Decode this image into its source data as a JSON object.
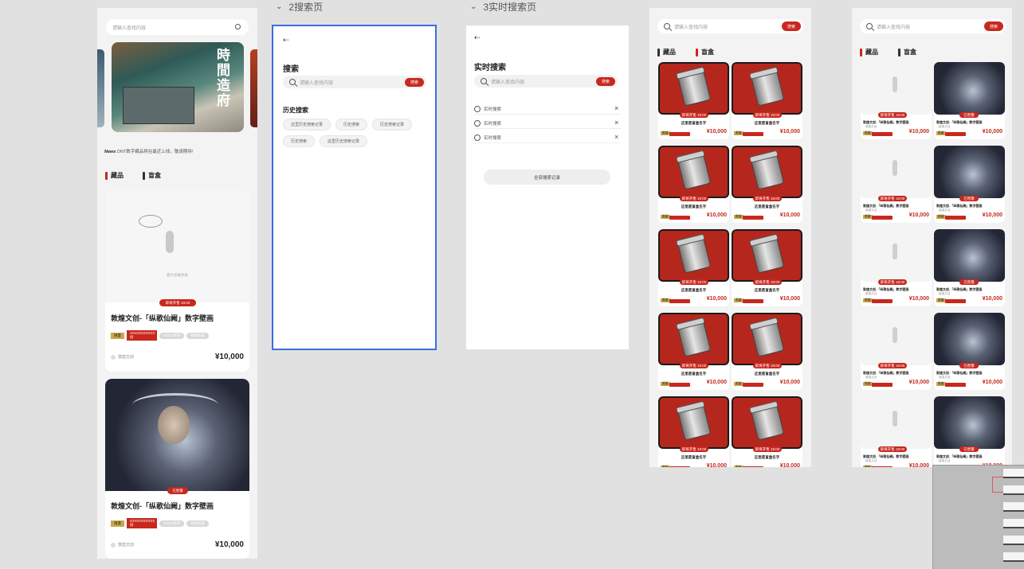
{
  "frame1": {
    "search_placeholder": "请输入查找内容",
    "news_label": "News",
    "news_text": "DNT数字藏品将在最近上线，敬请期待!",
    "tabs": [
      "藏品",
      "盲盒"
    ],
    "banner_title": "時間造府",
    "card1": {
      "empty_text": "图片加载失败",
      "badge": "即将开售 19:00",
      "title": "敦煌文创-「纵歌仙阙」数字壁画",
      "tag1": "限量",
      "tag1_value": "XXXX/XXXXXX份",
      "tag2": "XXXX系列",
      "tag3": "系列标签",
      "creator": "敦煌文创",
      "price": "¥10,000"
    },
    "card2": {
      "badge": "已售罄",
      "title": "敦煌文创-「纵歌仙阙」数字壁画",
      "tag1": "限量",
      "tag1_value": "XXXX/XXXXXX份",
      "tag2": "XXXX系列",
      "tag3": "系列标签",
      "creator": "敦煌文创",
      "price": "¥10,000"
    }
  },
  "frame2": {
    "header": "2搜索页",
    "back_icon": "back-icon",
    "title": "搜索",
    "search_placeholder": "请输入查找内容",
    "search_button": "搜索",
    "history_title": "历史搜索",
    "history": [
      "这里历史搜索记录",
      "历史搜索",
      "历史搜索记录",
      "历史搜索",
      "这里历史搜索记录"
    ]
  },
  "frame3": {
    "header": "3实时搜索页",
    "title": "实时搜索",
    "search_placeholder": "请输入查找内容",
    "search_button": "搜索",
    "results": [
      "实时搜索",
      "实时搜索",
      "实时搜索"
    ],
    "all_button": "全部搜索记录"
  },
  "frame4": {
    "search_placeholder": "请输入查找内容",
    "search_button": "搜索",
    "tabs": [
      "藏品",
      "盲盒"
    ],
    "card_badge": "即将开售 19:00",
    "card_badge_sold": "已售罄",
    "card_name": "这里是盲盒名字",
    "tag": "限量",
    "price": "¥10,000"
  },
  "frame5": {
    "search_placeholder": "请输入查找内容",
    "search_button": "搜索",
    "tabs": [
      "藏品",
      "盲盒"
    ],
    "card_badge": "即将开售 19:00",
    "card_badge_sold": "已售罄",
    "card_title": "敦煌文创-「纵歌仙阙」数字壁画",
    "creator": "敦煌文创",
    "tag": "限量",
    "price": "¥10,000"
  },
  "colors": {
    "accent": "#c8281e",
    "canvas": "#e1e1e1",
    "selection": "#3b6fe0"
  }
}
